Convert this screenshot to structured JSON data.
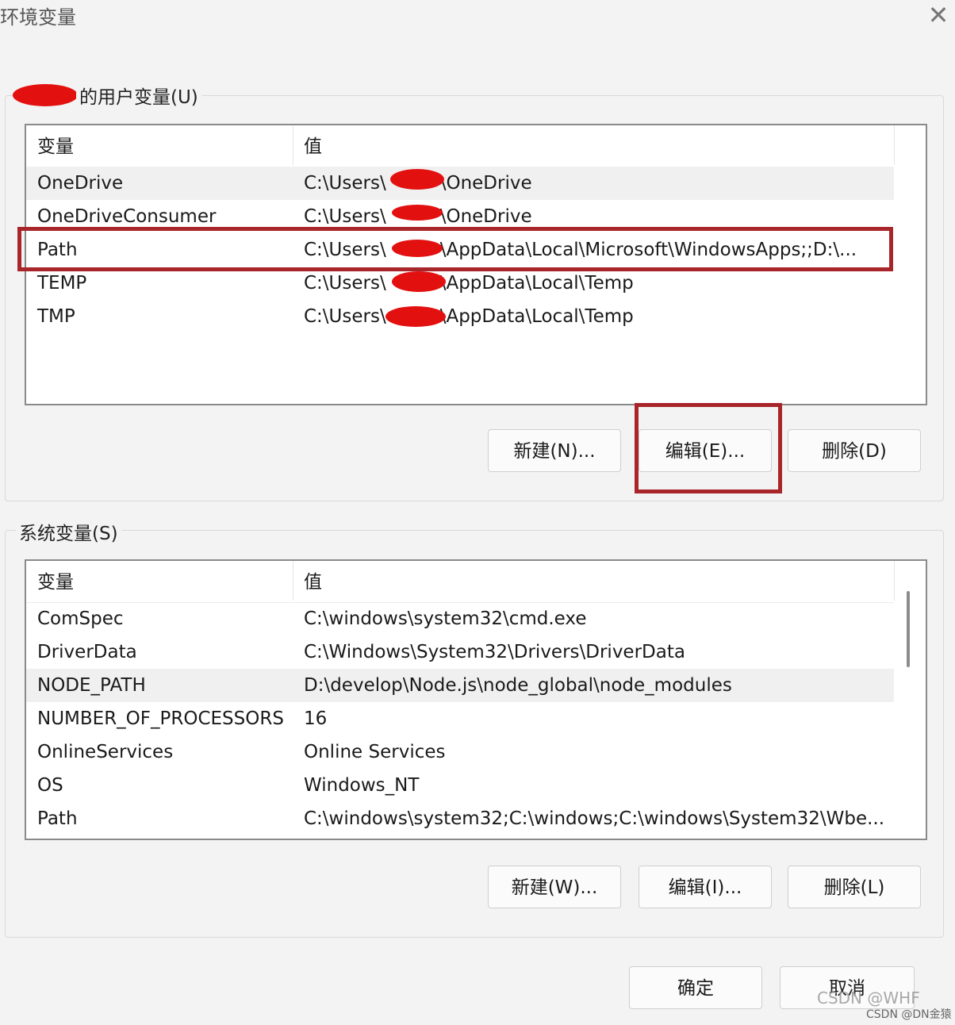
{
  "window": {
    "title": "环境变量",
    "close_icon": "✕"
  },
  "user_vars": {
    "group_label": "的用户变量(U)",
    "columns": {
      "name": "变量",
      "value": "值"
    },
    "rows": [
      {
        "name": "OneDrive",
        "value_prefix": "C:\\Users\\",
        "value_suffix": "\\OneDrive"
      },
      {
        "name": "OneDriveConsumer",
        "value_prefix": "C:\\Users\\",
        "value_suffix": "\\OneDrive"
      },
      {
        "name": "Path",
        "value_prefix": "C:\\Users\\",
        "value_suffix": "\\AppData\\Local\\Microsoft\\WindowsApps;;D:\\..."
      },
      {
        "name": "TEMP",
        "value_prefix": "C:\\Users\\",
        "value_suffix": "\\AppData\\Local\\Temp"
      },
      {
        "name": "TMP",
        "value_prefix": "C:\\Users\\",
        "value_suffix": "\\AppData\\Local\\Temp"
      }
    ],
    "buttons": {
      "new": "新建(N)...",
      "edit": "编辑(E)...",
      "delete": "删除(D)"
    }
  },
  "system_vars": {
    "group_label": "系统变量(S)",
    "columns": {
      "name": "变量",
      "value": "值"
    },
    "rows": [
      {
        "name": "ComSpec",
        "value": "C:\\windows\\system32\\cmd.exe"
      },
      {
        "name": "DriverData",
        "value": "C:\\Windows\\System32\\Drivers\\DriverData"
      },
      {
        "name": "NODE_PATH",
        "value": "D:\\develop\\Node.js\\node_global\\node_modules"
      },
      {
        "name": "NUMBER_OF_PROCESSORS",
        "value": "16"
      },
      {
        "name": "OnlineServices",
        "value": "Online Services"
      },
      {
        "name": "OS",
        "value": "Windows_NT"
      },
      {
        "name": "Path",
        "value": "C:\\windows\\system32;C:\\windows;C:\\windows\\System32\\Wbe..."
      }
    ],
    "buttons": {
      "new": "新建(W)...",
      "edit": "编辑(I)...",
      "delete": "删除(L)"
    }
  },
  "footer": {
    "ok": "确定",
    "cancel": "取消"
  },
  "watermarks": {
    "main": "CSDN @WHF",
    "small": "CSDN @DN金猿"
  },
  "colors": {
    "redaction": "#e31010",
    "highlight": "#a8262a"
  }
}
